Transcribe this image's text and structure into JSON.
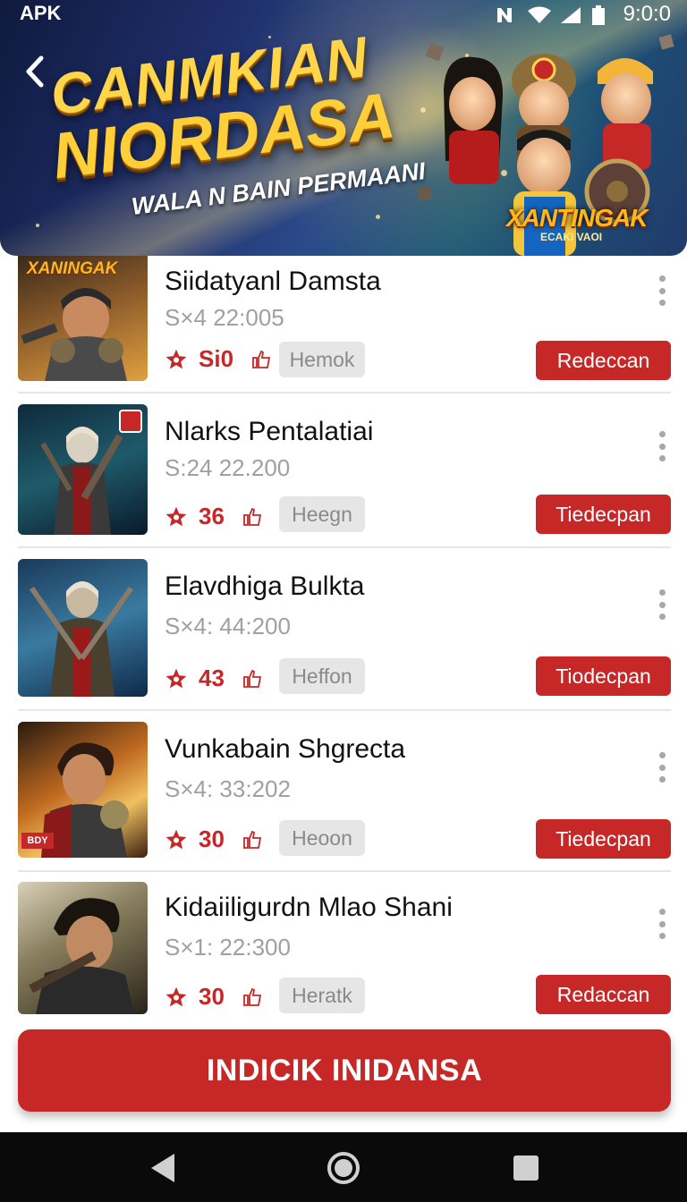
{
  "status_bar": {
    "carrier": "APK",
    "time": "9:0:0"
  },
  "banner": {
    "title_line1": "CANMKIAN",
    "title_line2": "NIORDASA",
    "subtitle": "WALA N BAIN PERMAANI",
    "logo": "XANTINGAK",
    "logo_sub": "ECAKI VAOI"
  },
  "items": [
    {
      "title": "Siidatyanl Damsta",
      "meta": "S×4 22:005",
      "rating": "Si0",
      "tag": "Hemok",
      "cta": "Redeccan",
      "thumb_label": "XANINGAK"
    },
    {
      "title": "Nlarks Pentalatiai",
      "meta": "S:24 22.200",
      "rating": "36",
      "tag": "Heegn",
      "cta": "Tiedecpan"
    },
    {
      "title": "Elavdhiga Bulkta",
      "meta": "S×4: 44:200",
      "rating": "43",
      "tag": "Heffon",
      "cta": "Tiodecpan"
    },
    {
      "title": "Vunkabain Shgrecta",
      "meta": "S×4: 33:202",
      "rating": "30",
      "tag": "Heoon",
      "cta": "Tiedecpan",
      "thumb_label": "BDY"
    },
    {
      "title": "Kidaiiligurdn Mlao Shani",
      "meta": "S×1: 22:300",
      "rating": "30",
      "tag": "Heratk",
      "cta": "Redaccan"
    }
  ],
  "primary_cta": "INDICIK INIDANSA",
  "colors": {
    "accent": "#c62828",
    "divider": "#e6e6e6",
    "tag_bg": "#e6e6e6",
    "muted_text": "#a0a0a0"
  },
  "icons": [
    "back-arrow-icon",
    "wifi-icon",
    "signal-icon",
    "battery-icon",
    "star-icon",
    "thumbs-up-icon",
    "more-vertical-icon",
    "nav-back-icon",
    "nav-home-icon",
    "nav-recents-icon"
  ]
}
